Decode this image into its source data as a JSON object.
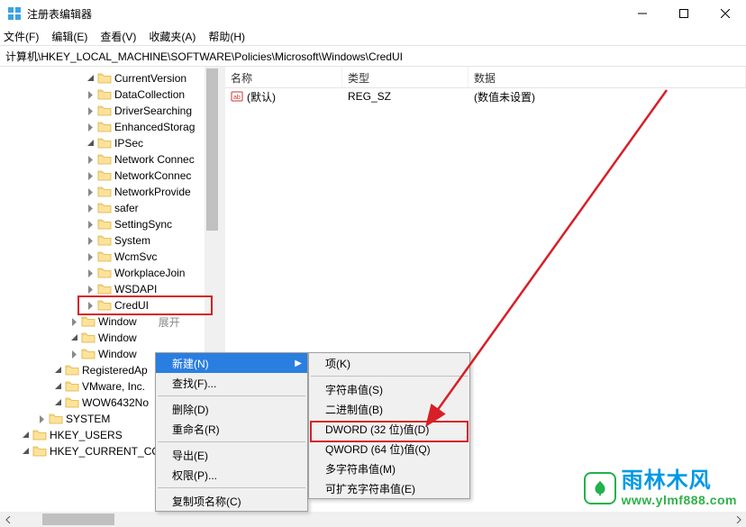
{
  "window_title": "注册表编辑器",
  "menu": {
    "file": "文件(F)",
    "edit": "编辑(E)",
    "view": "查看(V)",
    "favorites": "收藏夹(A)",
    "help": "帮助(H)"
  },
  "address": "计算机\\HKEY_LOCAL_MACHINE\\SOFTWARE\\Policies\\Microsoft\\Windows\\CredUI",
  "tree": {
    "items": [
      {
        "indent": 5,
        "exp": true,
        "label": "CurrentVersion"
      },
      {
        "indent": 5,
        "exp": false,
        "label": "DataCollection"
      },
      {
        "indent": 5,
        "exp": false,
        "label": "DriverSearching"
      },
      {
        "indent": 5,
        "exp": false,
        "label": "EnhancedStorag"
      },
      {
        "indent": 5,
        "exp": true,
        "label": "IPSec"
      },
      {
        "indent": 5,
        "exp": false,
        "label": "Network Connec"
      },
      {
        "indent": 5,
        "exp": false,
        "label": "NetworkConnec"
      },
      {
        "indent": 5,
        "exp": false,
        "label": "NetworkProvide"
      },
      {
        "indent": 5,
        "exp": false,
        "label": "safer"
      },
      {
        "indent": 5,
        "exp": false,
        "label": "SettingSync"
      },
      {
        "indent": 5,
        "exp": false,
        "label": "System"
      },
      {
        "indent": 5,
        "exp": false,
        "label": "WcmSvc"
      },
      {
        "indent": 5,
        "exp": false,
        "label": "WorkplaceJoin"
      },
      {
        "indent": 5,
        "exp": false,
        "label": "WSDAPI"
      },
      {
        "indent": 5,
        "exp": false,
        "label": "CredUI",
        "selected": true
      },
      {
        "indent": 4,
        "exp": false,
        "label": "Window",
        "tail": "展开"
      },
      {
        "indent": 4,
        "exp": true,
        "label": "Window"
      },
      {
        "indent": 4,
        "exp": false,
        "label": "Window"
      },
      {
        "indent": 3,
        "exp": true,
        "label": "RegisteredAp"
      },
      {
        "indent": 3,
        "exp": true,
        "label": "VMware, Inc."
      },
      {
        "indent": 3,
        "exp": true,
        "label": "WOW6432No"
      },
      {
        "indent": 2,
        "exp": false,
        "label": "SYSTEM"
      },
      {
        "indent": 1,
        "exp": true,
        "label": "HKEY_USERS"
      },
      {
        "indent": 1,
        "exp": true,
        "label": "HKEY_CURRENT_CO"
      }
    ]
  },
  "list": {
    "headers": {
      "name": "名称",
      "type": "类型",
      "data": "数据"
    },
    "rows": [
      {
        "name": "(默认)",
        "type": "REG_SZ",
        "data": "(数值未设置)"
      }
    ]
  },
  "ctx1": {
    "disabled0": "展开",
    "new": "新建(N)",
    "find": "查找(F)...",
    "delete": "删除(D)",
    "rename": "重命名(R)",
    "export": "导出(E)",
    "perm": "权限(P)...",
    "copykey": "复制项名称(C)"
  },
  "ctx2": {
    "key": "项(K)",
    "string": "字符串值(S)",
    "binary": "二进制值(B)",
    "dword32": "DWORD (32 位)值(D)",
    "qword64": "QWORD (64 位)值(Q)",
    "multi": "多字符串值(M)",
    "expand": "可扩充字符串值(E)"
  },
  "watermark": {
    "brand": "雨林木风",
    "url": "www.ylmf888.com"
  }
}
